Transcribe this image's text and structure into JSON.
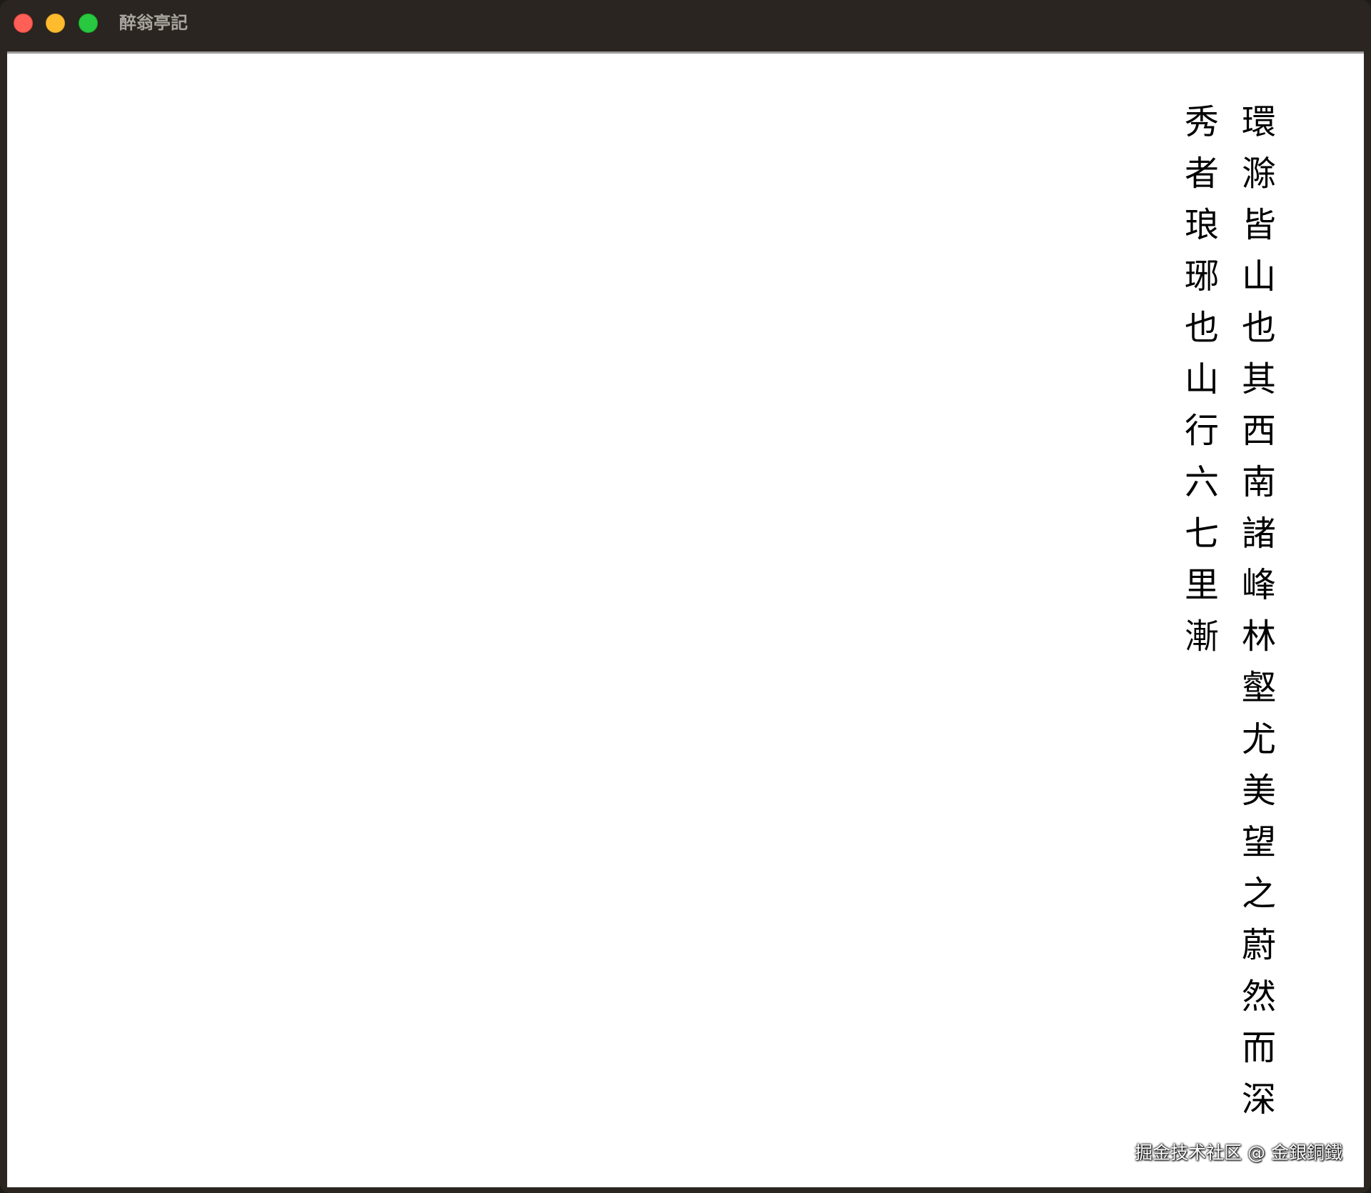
{
  "window": {
    "title": "醉翁亭記"
  },
  "article": {
    "lines": [
      "環滁皆山也其西南諸峰林壑尤美望之蔚然而深",
      "秀者琅琊也山行六七里漸"
    ]
  },
  "watermark": "掘金技术社区 @ 金銀銅鐵",
  "colors": {
    "titlebar": "#2a2520",
    "content_bg": "#ffffff",
    "text": "#000000",
    "close": "#fe5f57",
    "minimize": "#febb2e",
    "maximize": "#28c840"
  }
}
